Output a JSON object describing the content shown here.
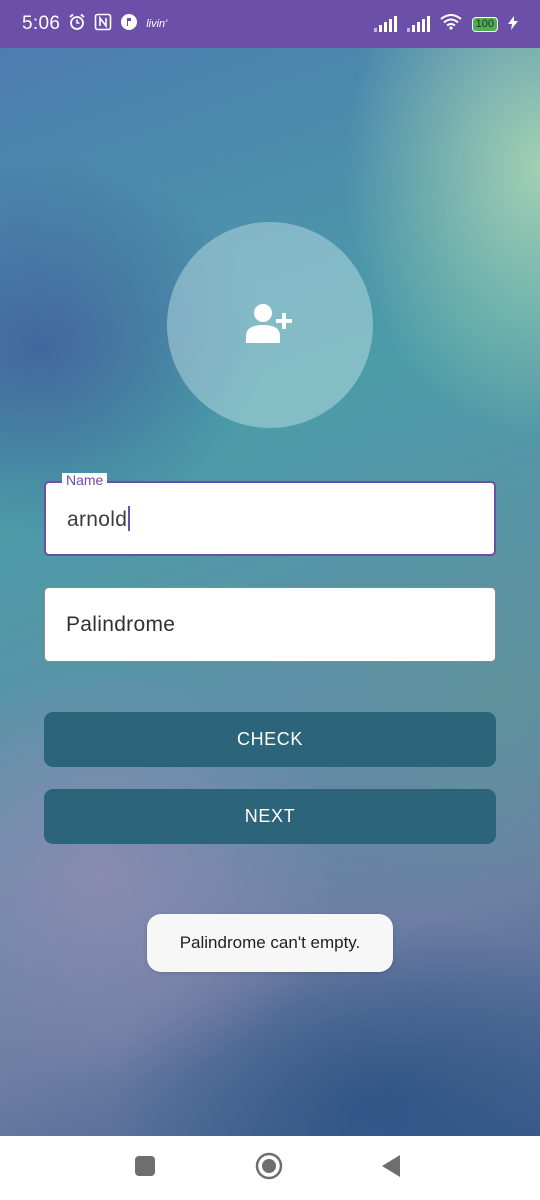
{
  "status_bar": {
    "time": "5:06",
    "icons": [
      "alarm-icon",
      "nfc-icon",
      "app-notification-icon",
      "livin-icon"
    ],
    "livin_label": "livin'",
    "battery_level": "100",
    "right_icons": [
      "signal-sim1-icon",
      "signal-sim2-icon",
      "wifi-icon",
      "battery-icon",
      "charging-bolt-icon"
    ]
  },
  "colors": {
    "status_bar": "#6b4fa8",
    "accent": "#6a4ea8",
    "button": "#2c6479"
  },
  "avatar": {
    "icon": "add-person-icon"
  },
  "form": {
    "name_label": "Name",
    "name_value": "arnold",
    "palindrome_value": "Palindrome"
  },
  "buttons": {
    "check": "CHECK",
    "next": "NEXT"
  },
  "toast": {
    "message": "Palindrome can't empty."
  },
  "nav": {
    "icons": [
      "recents-square-icon",
      "home-circle-icon",
      "back-triangle-icon"
    ]
  }
}
